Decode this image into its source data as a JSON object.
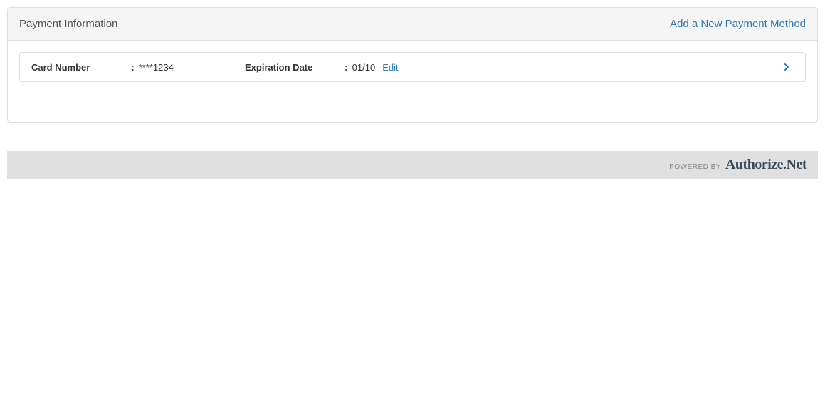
{
  "panel": {
    "title": "Payment Information",
    "add_link": "Add a New Payment Method"
  },
  "card": {
    "number_label": "Card Number",
    "number_value": "****1234",
    "expiry_label": "Expiration Date",
    "expiry_value": "01/10",
    "edit_label": "Edit"
  },
  "footer": {
    "powered_by": "POWERED BY",
    "brand": "Authorize.Net"
  }
}
